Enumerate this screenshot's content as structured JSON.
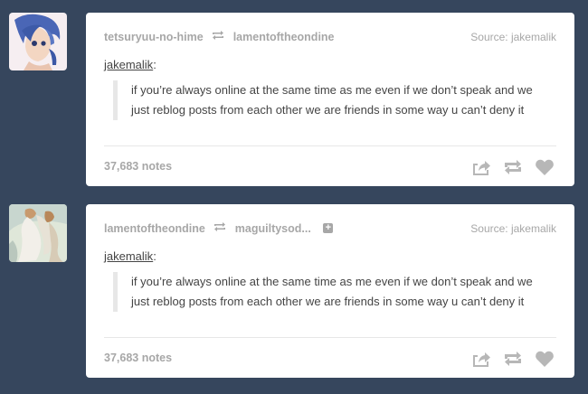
{
  "colors": {
    "background": "#36465d",
    "card": "#ffffff",
    "muted_text": "#a7a7a7",
    "body_text": "#444444",
    "icon_grey": "#b7b7b7",
    "quote_border": "#e7e7e7"
  },
  "posts": [
    {
      "header": {
        "blog": "tetsuryuu-no-hime",
        "reblogged_from": "lamentoftheondine",
        "source": "Source: jakemalik"
      },
      "quote_author": "jakemalik",
      "quote_author_suffix": ":",
      "quote_text": "if you’re always online at the same time as me even if we don’t speak and we just reblog posts from each other we are friends in some way u can’t deny it",
      "notes": "37,683 notes",
      "icons": [
        "share-icon",
        "reblog-icon",
        "like-heart-icon"
      ]
    },
    {
      "header": {
        "blog": "lamentoftheondine",
        "reblogged_from": "maguiltysod...",
        "follow_symbol": "+",
        "source": "Source: jakemalik"
      },
      "quote_author": "jakemalik",
      "quote_author_suffix": ":",
      "quote_text": "if you’re always online at the same time as me even if we don’t speak and we just reblog posts from each other we are friends in some way u can’t deny it",
      "notes": "37,683 notes",
      "icons": [
        "share-icon",
        "reblog-icon",
        "like-heart-icon"
      ]
    }
  ]
}
